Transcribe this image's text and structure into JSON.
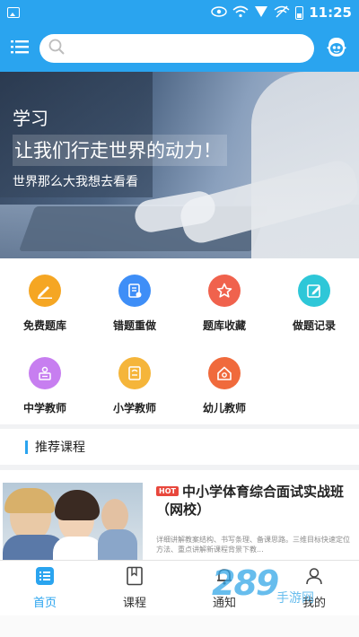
{
  "status_bar": {
    "time": "11:25",
    "icons": [
      "image-icon",
      "eye-icon",
      "wifi-icon",
      "signal-icon",
      "no-sim-icon",
      "battery-icon"
    ]
  },
  "header": {
    "menu_icon": "list-icon",
    "search_placeholder": "",
    "avatar_icon": "avatar-icon",
    "accent_color": "#2aa4ef"
  },
  "banner": {
    "line1": "学习",
    "line2": "让我们行走世界的动力！",
    "line3": "世界那么大我想去看看"
  },
  "grid": {
    "items": [
      {
        "label": "免费题库",
        "icon": "pencil-icon",
        "color": "#f5a623"
      },
      {
        "label": "错题重做",
        "icon": "document-icon",
        "color": "#3e8ef7"
      },
      {
        "label": "题库收藏",
        "icon": "star-icon",
        "color": "#f0624d"
      },
      {
        "label": "做题记录",
        "icon": "edit-icon",
        "color": "#2ec7d8"
      },
      {
        "label": "中学教师",
        "icon": "teacher-icon",
        "color": "#c77ef0"
      },
      {
        "label": "小学教师",
        "icon": "book-icon",
        "color": "#f5b53a"
      },
      {
        "label": "幼儿教师",
        "icon": "house-icon",
        "color": "#f06a3c"
      }
    ]
  },
  "section": {
    "title": "推荐课程"
  },
  "course": {
    "badge": "HOT",
    "title": "中小学体育综合面试实战班（网校）",
    "description": "详细讲解教案结构、书写条理、备课思路。三维目标快速定位方法、重点讲解新课程背景下教..."
  },
  "tabs": [
    {
      "label": "首页",
      "icon": "home-icon",
      "active": true
    },
    {
      "label": "课程",
      "icon": "course-icon",
      "active": false
    },
    {
      "label": "通知",
      "icon": "bell-icon",
      "active": false
    },
    {
      "label": "我的",
      "icon": "user-icon",
      "active": false
    }
  ],
  "watermark": {
    "number": "289",
    "text": "手游网"
  }
}
